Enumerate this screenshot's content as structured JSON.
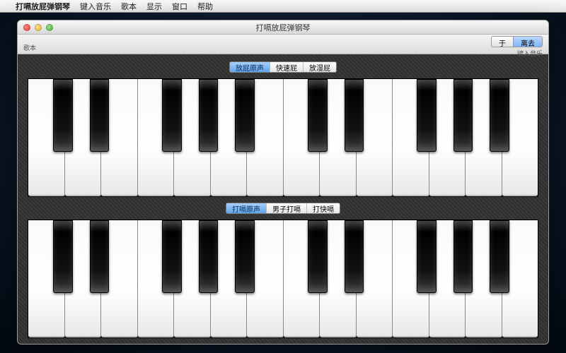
{
  "menubar": {
    "apple": "",
    "app_name": "打嗝放屁弹钢琴",
    "items": [
      "键入音乐",
      "歌本",
      "显示",
      "窗口",
      "帮助"
    ]
  },
  "window": {
    "title": "打嗝放屁弹钢琴",
    "toolbar": {
      "left_label": "歌本",
      "button_about": "于",
      "button_leave": "离去",
      "right_label": "键入音乐"
    }
  },
  "segmented_top": {
    "options": [
      "放屁原声",
      "快速屁",
      "放湿屁"
    ],
    "active_index": 0
  },
  "segmented_bottom": {
    "options": [
      "打嗝原声",
      "男子打嗝",
      "打快嗝"
    ],
    "active_index": 0
  },
  "piano": {
    "white_keys_count": 14,
    "black_positions_pct": [
      4.9,
      12.05,
      26.3,
      33.45,
      40.6,
      54.9,
      62.05,
      76.3,
      83.45,
      90.6
    ]
  }
}
